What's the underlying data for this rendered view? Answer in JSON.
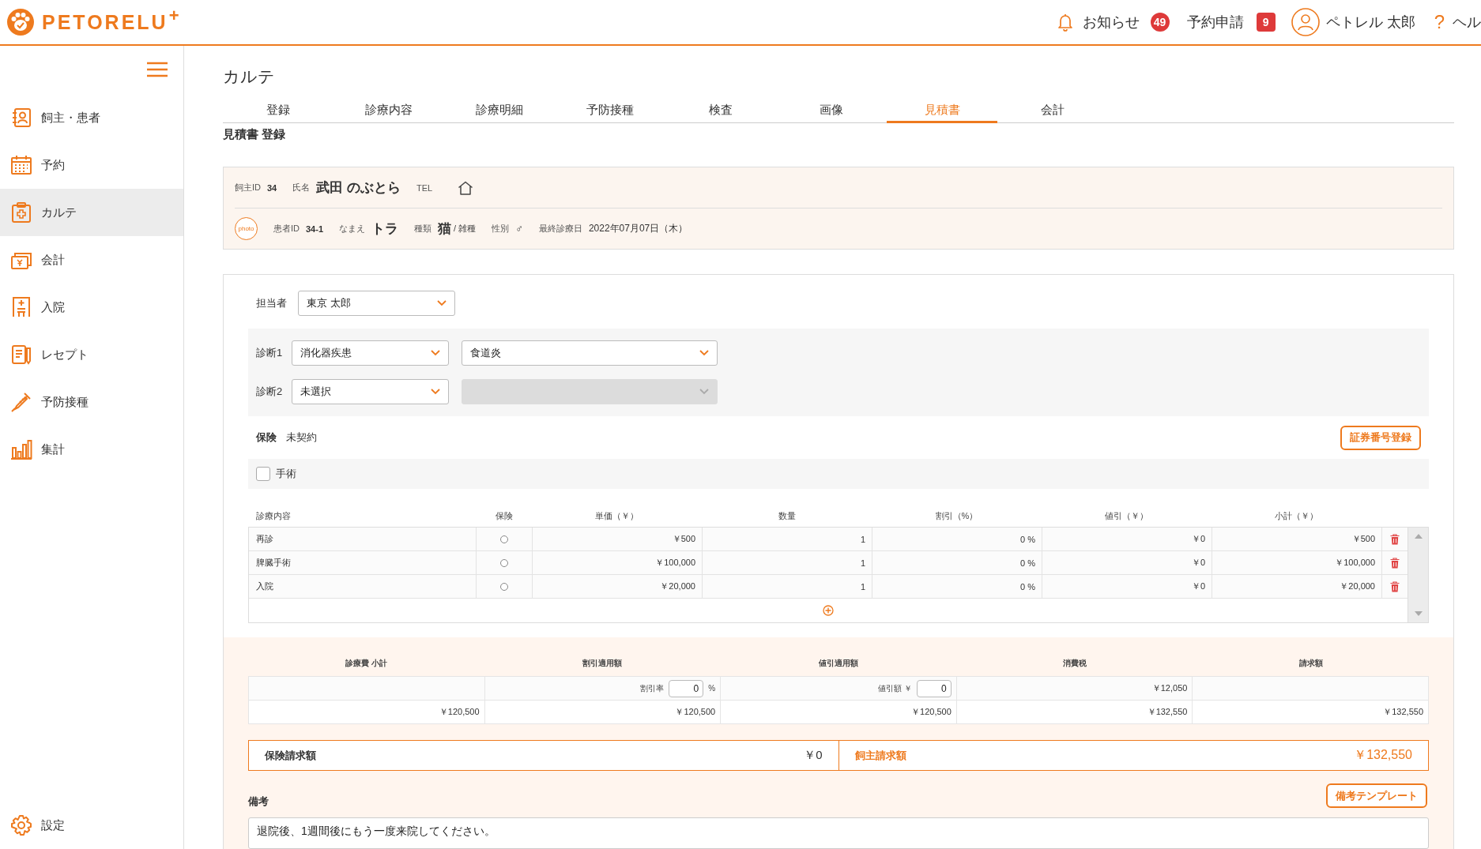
{
  "header": {
    "logo": {
      "name": "PETORELU",
      "mark": "+"
    },
    "notices": {
      "label": "お知らせ",
      "count": "49"
    },
    "requests": {
      "label": "予約申請",
      "count": "9"
    },
    "user": {
      "name": "ペトレル 太郎"
    },
    "help": {
      "icon": "?",
      "label": "ヘル"
    }
  },
  "sidebar": {
    "items": [
      {
        "kind": "owner",
        "label": "飼主・患者",
        "selected": false
      },
      {
        "kind": "calendar",
        "label": "予約",
        "selected": false
      },
      {
        "kind": "karte",
        "label": "カルテ",
        "selected": true
      },
      {
        "kind": "accounting",
        "label": "会計",
        "selected": false
      },
      {
        "kind": "hospital",
        "label": "入院",
        "selected": false
      },
      {
        "kind": "receipt",
        "label": "レセプト",
        "selected": false
      },
      {
        "kind": "vaccine",
        "label": "予防接種",
        "selected": false
      },
      {
        "kind": "stats",
        "label": "集計",
        "selected": false
      }
    ],
    "settings": {
      "label": "設定"
    }
  },
  "page": {
    "title": "カルテ",
    "tabs": [
      {
        "label": "登録",
        "selected": false
      },
      {
        "label": "診療内容",
        "selected": false
      },
      {
        "label": "診療明細",
        "selected": false
      },
      {
        "label": "予防接種",
        "selected": false
      },
      {
        "label": "検査",
        "selected": false
      },
      {
        "label": "画像",
        "selected": false
      },
      {
        "label": "見積書",
        "selected": true
      },
      {
        "label": "会計",
        "selected": false
      }
    ],
    "subtitle": "見積書 登録"
  },
  "patient_card": {
    "owner": {
      "id_label": "飼主ID",
      "id": "34",
      "name_label": "氏名",
      "name": "武田 のぶとら",
      "tel_label": "TEL"
    },
    "pet": {
      "photo_label": "photo",
      "id_label": "患者ID",
      "id": "34-1",
      "name_label": "なまえ",
      "name": "トラ",
      "species_label": "種類",
      "species": "猫",
      "breed": "/ 雑種",
      "sex_label": "性別",
      "sex": "♂",
      "last_visit_label": "最終診療日",
      "last_visit": "2022年07月07日（木）"
    }
  },
  "estimate": {
    "staff": {
      "label": "担当者",
      "value": "東京 太郎"
    },
    "diagnoses": [
      {
        "label": "診断1",
        "category": "消化器疾患",
        "detail": "食道炎",
        "detail_disabled": false
      },
      {
        "label": "診断2",
        "category": "未選択",
        "detail_disabled": true
      }
    ],
    "insurance": {
      "label": "保険",
      "value": "未契約",
      "button": "証券番号登録"
    },
    "surgery": {
      "label": "手術",
      "checked": false
    },
    "items": {
      "columns": [
        "診療内容",
        "保険",
        "単価（￥）",
        "数量",
        "割引（%）",
        "値引（￥）",
        "小計（￥）"
      ],
      "rows": [
        {
          "name": "再診",
          "insured": false,
          "price": "￥500",
          "qty": "1",
          "discount_rate": "0 %",
          "discount": "￥0",
          "subtotal": "￥500"
        },
        {
          "name": "脾臓手術",
          "insured": false,
          "price": "￥100,000",
          "qty": "1",
          "discount_rate": "0 %",
          "discount": "￥0",
          "subtotal": "￥100,000"
        },
        {
          "name": "入院",
          "insured": false,
          "price": "￥20,000",
          "qty": "1",
          "discount_rate": "0 %",
          "discount": "￥0",
          "subtotal": "￥20,000"
        }
      ]
    },
    "summary": {
      "columns": [
        "診療費 小計",
        "割引適用額",
        "値引適用額",
        "消費税",
        "請求額"
      ],
      "discount_rate_label": "割引率",
      "discount_rate": "0",
      "discount_rate_unit": "%",
      "discount_amount_label": "値引額 ￥",
      "discount_amount": "0",
      "tax": "￥12,050",
      "totals": [
        "￥120,500",
        "￥120,500",
        "￥120,500",
        "￥132,550",
        "￥132,550"
      ]
    },
    "billing": {
      "insurance": {
        "label": "保険請求額",
        "amount": "￥0"
      },
      "owner": {
        "label": "飼主請求額",
        "amount": "￥132,550"
      }
    },
    "notes": {
      "label": "備考",
      "button": "備考テンプレート",
      "value": "退院後、1週間後にもう一度来院してください。"
    }
  }
}
